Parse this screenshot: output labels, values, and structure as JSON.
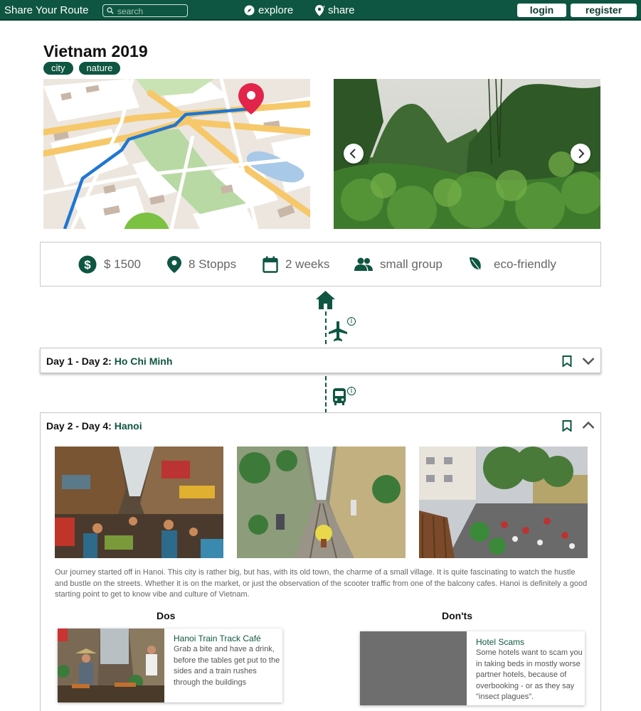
{
  "header": {
    "brand": "Share Your Route",
    "search_placeholder": "search",
    "explore_label": "explore",
    "share_label": "share",
    "login_label": "login",
    "register_label": "register",
    "bg_color": "#0e5641"
  },
  "route": {
    "title": "Vietnam 2019",
    "tags": [
      "city",
      "nature"
    ]
  },
  "facts": {
    "budget": "$ 1500",
    "stops": "8 Stopps",
    "duration": "2 weeks",
    "group": "small group",
    "eco": "eco-friendly"
  },
  "days": [
    {
      "range": "Day 1 - Day 2: ",
      "city": "Ho Chi Minh",
      "expanded": false
    },
    {
      "range": "Day 2 - Day 4: ",
      "city": "Hanoi",
      "expanded": true,
      "description": "Our journey started off in Hanoi. This city is rather big, but has, with its old town, the charme of a small village. It is quite fascinating to watch the hustle and bustle on the streets. Whether it is on the market, or just the observation of the scooter traffic from one of the balcony cafes. Hanoi is definitely a good starting point to get to know vibe and culture of Vietnam.",
      "dos_title": "Dos",
      "donts_title": "Don'ts",
      "dos": [
        {
          "title": "Hanoi Train Track Café",
          "text": "Grab a bite and have a drink, before the tables get put to the sides and a train rushes through the buildings"
        }
      ],
      "donts": [
        {
          "title": "Hotel Scams",
          "text": "Some hotels want to scam you in taking beds in mostly worse partner hotels, because of overbooking - or  as they say \"insect plagues\"."
        }
      ]
    }
  ],
  "icons": {
    "search": "search-icon",
    "explore": "compass-icon",
    "share": "map-pin-icon",
    "budget": "dollar-icon",
    "stops": "location-pin-icon",
    "duration": "calendar-icon",
    "group": "group-icon",
    "eco": "leaf-icon",
    "home": "home-icon",
    "plane": "airplane-icon",
    "bus": "bus-icon",
    "bookmark": "bookmark-icon",
    "info": "info-icon"
  }
}
